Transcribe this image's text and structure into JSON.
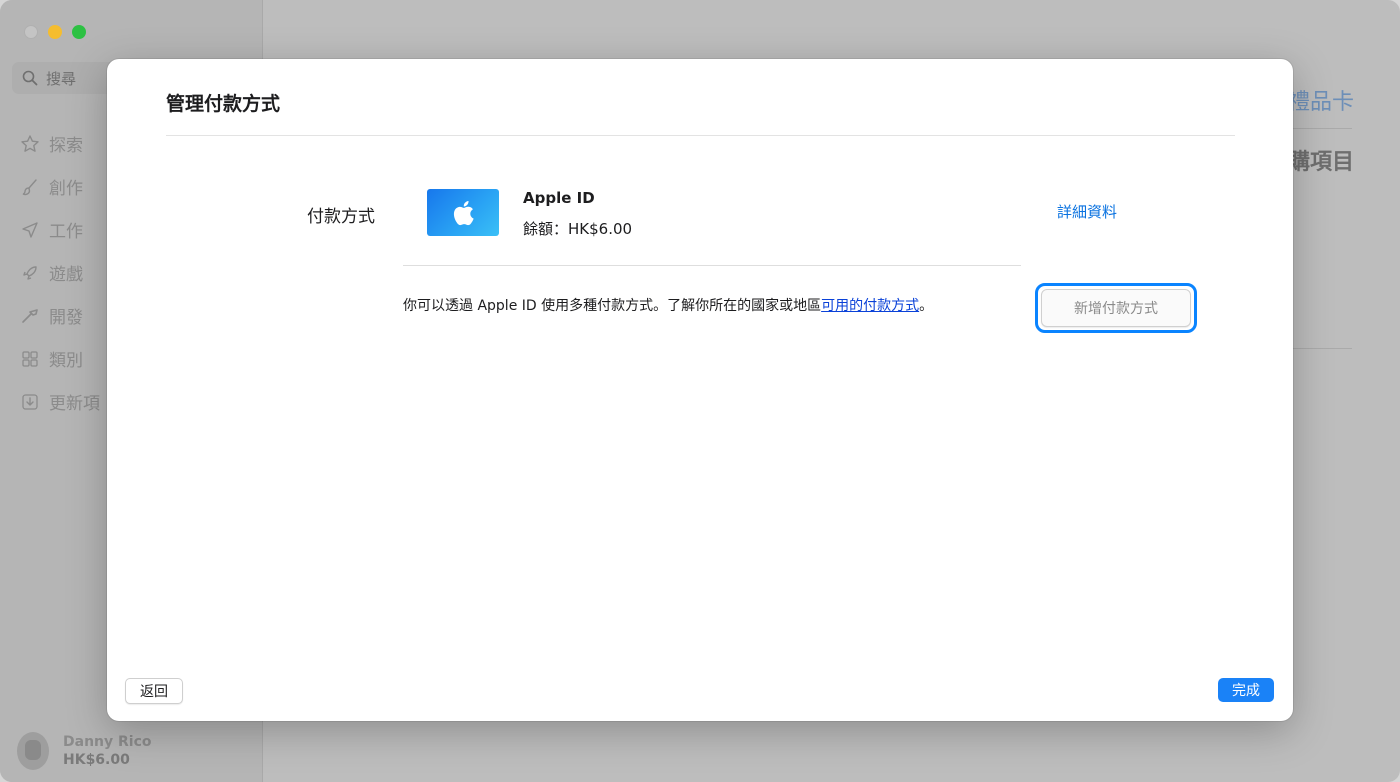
{
  "sidebar": {
    "search_placeholder": "搜尋",
    "items": [
      {
        "label": "探索",
        "icon": "star-icon"
      },
      {
        "label": "創作",
        "icon": "brush-icon"
      },
      {
        "label": "工作",
        "icon": "paper-plane-icon"
      },
      {
        "label": "遊戲",
        "icon": "rocket-icon"
      },
      {
        "label": "開發",
        "icon": "hammer-icon"
      },
      {
        "label": "類別",
        "icon": "grid-icon"
      },
      {
        "label": "更新項",
        "icon": "download-icon"
      }
    ],
    "account": {
      "name": "Danny Rico",
      "balance": "HK$6.00"
    }
  },
  "main": {
    "link_partial": "禮品卡",
    "heading_partial": "購項目"
  },
  "modal": {
    "title": "管理付款方式",
    "section_label": "付款方式",
    "payment": {
      "name": "Apple ID",
      "balance": "餘額：HK$6.00",
      "details_link": "詳細資料",
      "card_icon": "apple-logo-icon"
    },
    "info": {
      "text": "你可以透過 Apple ID 使用多種付款方式。了解你所在的國家或地區",
      "link": "可用的付款方式",
      "suffix": "。"
    },
    "add_button": "新增付款方式",
    "back_button": "返回",
    "done_button": "完成"
  },
  "colors": {
    "accent": "#0a84ff",
    "link": "#0a72e0",
    "card_gradient_start": "#1777ec",
    "card_gradient_end": "#3bc0f6",
    "traffic_min": "#f5bd2f",
    "traffic_max": "#2dc143"
  }
}
